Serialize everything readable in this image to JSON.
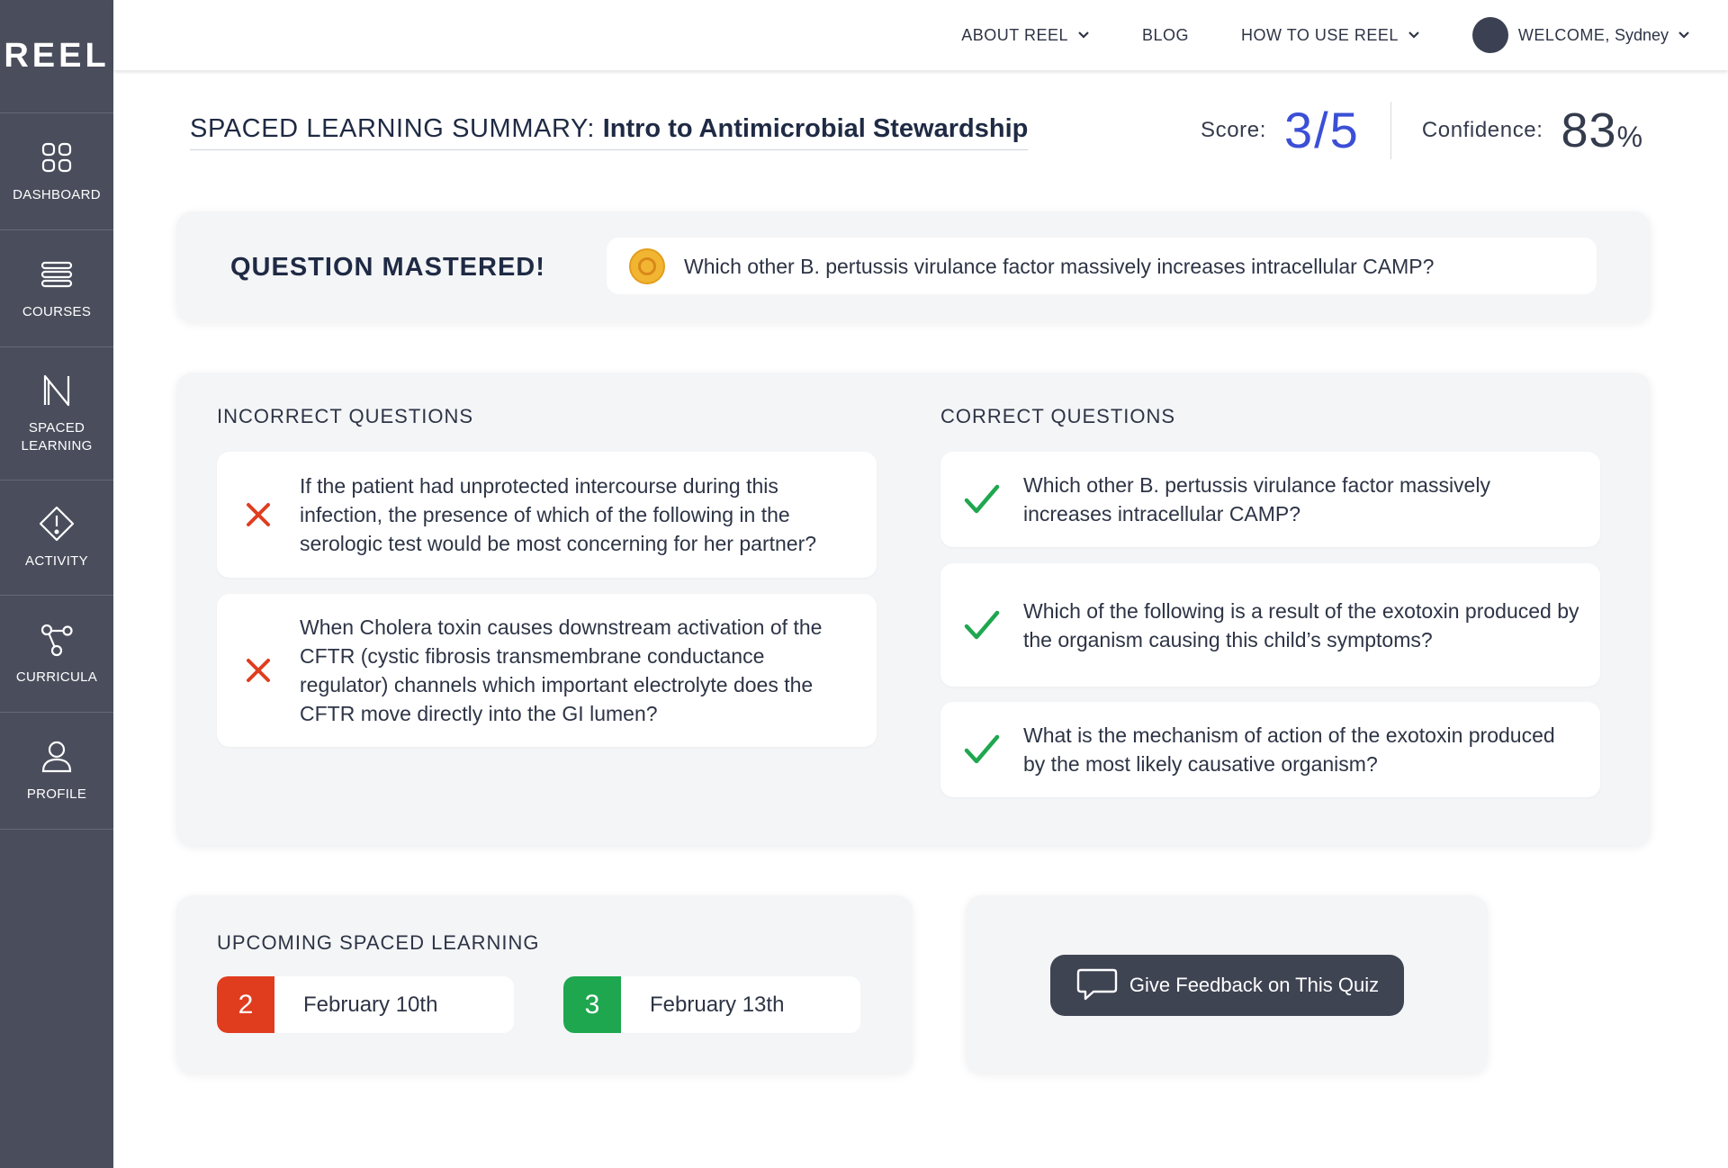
{
  "app": {
    "logo": "REEL"
  },
  "sidebar": {
    "items": [
      {
        "label": "DASHBOARD",
        "icon": "grid-icon"
      },
      {
        "label": "COURSES",
        "icon": "list-icon"
      },
      {
        "label": "SPACED\nLEARNING",
        "icon": "spaced-learning-icon"
      },
      {
        "label": "ACTIVITY",
        "icon": "alert-diamond-icon"
      },
      {
        "label": "CURRICULA",
        "icon": "nodes-icon"
      },
      {
        "label": "PROFILE",
        "icon": "person-icon"
      }
    ]
  },
  "topnav": {
    "about": "ABOUT REEL",
    "blog": "BLOG",
    "howto": "HOW TO USE REEL",
    "welcome_prefix": "WELCOME,",
    "welcome_name": "Sydney"
  },
  "summary": {
    "prefix": "SPACED LEARNING SUMMARY:",
    "course": "Intro to Antimicrobial Stewardship",
    "score_label": "Score:",
    "score_value": "3/5",
    "confidence_label": "Confidence:",
    "confidence_value": "83",
    "confidence_unit": "%"
  },
  "mastered": {
    "title": "QUESTION MASTERED!",
    "question": "Which other B. pertussis virulance factor massively increases intracellular CAMP?"
  },
  "incorrect": {
    "title": "INCORRECT QUESTIONS",
    "items": [
      "If the patient had unprotected intercourse during this infection, the presence of which of the following in the serologic test would be most concerning for her partner?",
      "When Cholera toxin causes downstream activation of the CFTR (cystic fibrosis transmembrane conductance regulator) channels which important electrolyte does the CFTR move directly into the GI lumen?"
    ]
  },
  "correct": {
    "title": "CORRECT QUESTIONS",
    "items": [
      "Which other B. pertussis virulance factor massively increases intracellular CAMP?",
      "Which of the following is a result of the exotoxin produced by the organism causing this child’s symptoms?",
      "What is the mechanism of action of the exotoxin produced by the most likely causative organism?"
    ]
  },
  "upcoming": {
    "title": "UPCOMING SPACED LEARNING",
    "items": [
      {
        "num": "2",
        "date": "February 10th",
        "color": "#e03d1f"
      },
      {
        "num": "3",
        "date": "February 13th",
        "color": "#1fa74f"
      }
    ]
  },
  "feedback": {
    "label": "Give Feedback on This Quiz"
  },
  "colors": {
    "score": "#3b4fd6",
    "incorrect": "#e03d1f",
    "correct": "#1fa74f",
    "sidebar": "#4a4e5c",
    "coin": "#f2b531"
  }
}
